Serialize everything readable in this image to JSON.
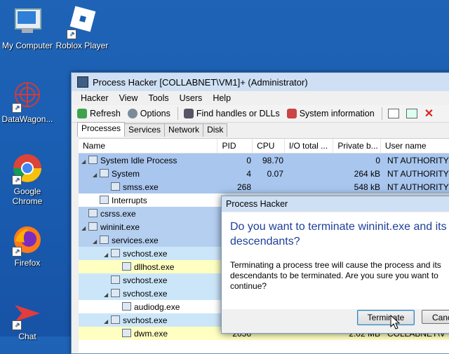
{
  "desktop": {
    "icons": [
      {
        "label": "My Computer",
        "icon": "computer-icon"
      },
      {
        "label": "Roblox Player",
        "icon": "roblox-icon"
      },
      {
        "label": "DataWagon...",
        "icon": "datawagon-icon"
      },
      {
        "label": "Google Chrome",
        "icon": "chrome-icon"
      },
      {
        "label": "Firefox",
        "icon": "firefox-icon"
      },
      {
        "label": "Chat",
        "icon": "chat-icon"
      }
    ]
  },
  "window": {
    "title": "Process Hacker [COLLABNET\\VM1]+ (Administrator)",
    "menu": [
      "Hacker",
      "View",
      "Tools",
      "Users",
      "Help"
    ],
    "toolbar": {
      "refresh": "Refresh",
      "options": "Options",
      "find_handles": "Find handles or DLLs",
      "system_info": "System information"
    },
    "tabs": [
      "Processes",
      "Services",
      "Network",
      "Disk"
    ],
    "columns": [
      "Name",
      "PID",
      "CPU",
      "I/O total ...",
      "Private b...",
      "User name"
    ],
    "rows": [
      {
        "name": "System Idle Process",
        "pid": "0",
        "cpu": "98.70",
        "io": "",
        "priv": "0",
        "user": "NT AUTHORITY"
      },
      {
        "name": "System",
        "pid": "4",
        "cpu": "0.07",
        "io": "",
        "priv": "264 kB",
        "user": "NT AUTHORITY"
      },
      {
        "name": "smss.exe",
        "pid": "268",
        "cpu": "",
        "io": "",
        "priv": "548 kB",
        "user": "NT AUTHORITY"
      },
      {
        "name": "Interrupts",
        "pid": "",
        "cpu": "",
        "io": "",
        "priv": "",
        "user": ""
      },
      {
        "name": "csrss.exe",
        "pid": "",
        "cpu": "",
        "io": "",
        "priv": "",
        "user": ""
      },
      {
        "name": "wininit.exe",
        "pid": "",
        "cpu": "",
        "io": "",
        "priv": "",
        "user": ""
      },
      {
        "name": "services.exe",
        "pid": "",
        "cpu": "",
        "io": "",
        "priv": "",
        "user": ""
      },
      {
        "name": "svchost.exe",
        "pid": "",
        "cpu": "",
        "io": "",
        "priv": "",
        "user": ""
      },
      {
        "name": "dllhost.exe",
        "pid": "",
        "cpu": "",
        "io": "",
        "priv": "",
        "user": ""
      },
      {
        "name": "svchost.exe",
        "pid": "",
        "cpu": "",
        "io": "",
        "priv": "",
        "user": ""
      },
      {
        "name": "svchost.exe",
        "pid": "",
        "cpu": "",
        "io": "",
        "priv": "",
        "user": ""
      },
      {
        "name": "audiodg.exe",
        "pid": "",
        "cpu": "",
        "io": "",
        "priv": "",
        "user": ""
      },
      {
        "name": "svchost.exe",
        "pid": "",
        "cpu": "",
        "io": "",
        "priv": "",
        "user": ""
      },
      {
        "name": "dwm.exe",
        "pid": "2056",
        "cpu": "",
        "io": "",
        "priv": "2.02 MB",
        "user": "COLLABNET\\V"
      }
    ]
  },
  "dialog": {
    "title": "Process Hacker",
    "question": "Do you want to terminate wininit.exe and its descendants?",
    "detail": "Terminating a process tree will cause the process and its descendants to be terminated. Are you sure you want to continue?",
    "terminate": "Terminate",
    "cancel": "Cancel"
  }
}
